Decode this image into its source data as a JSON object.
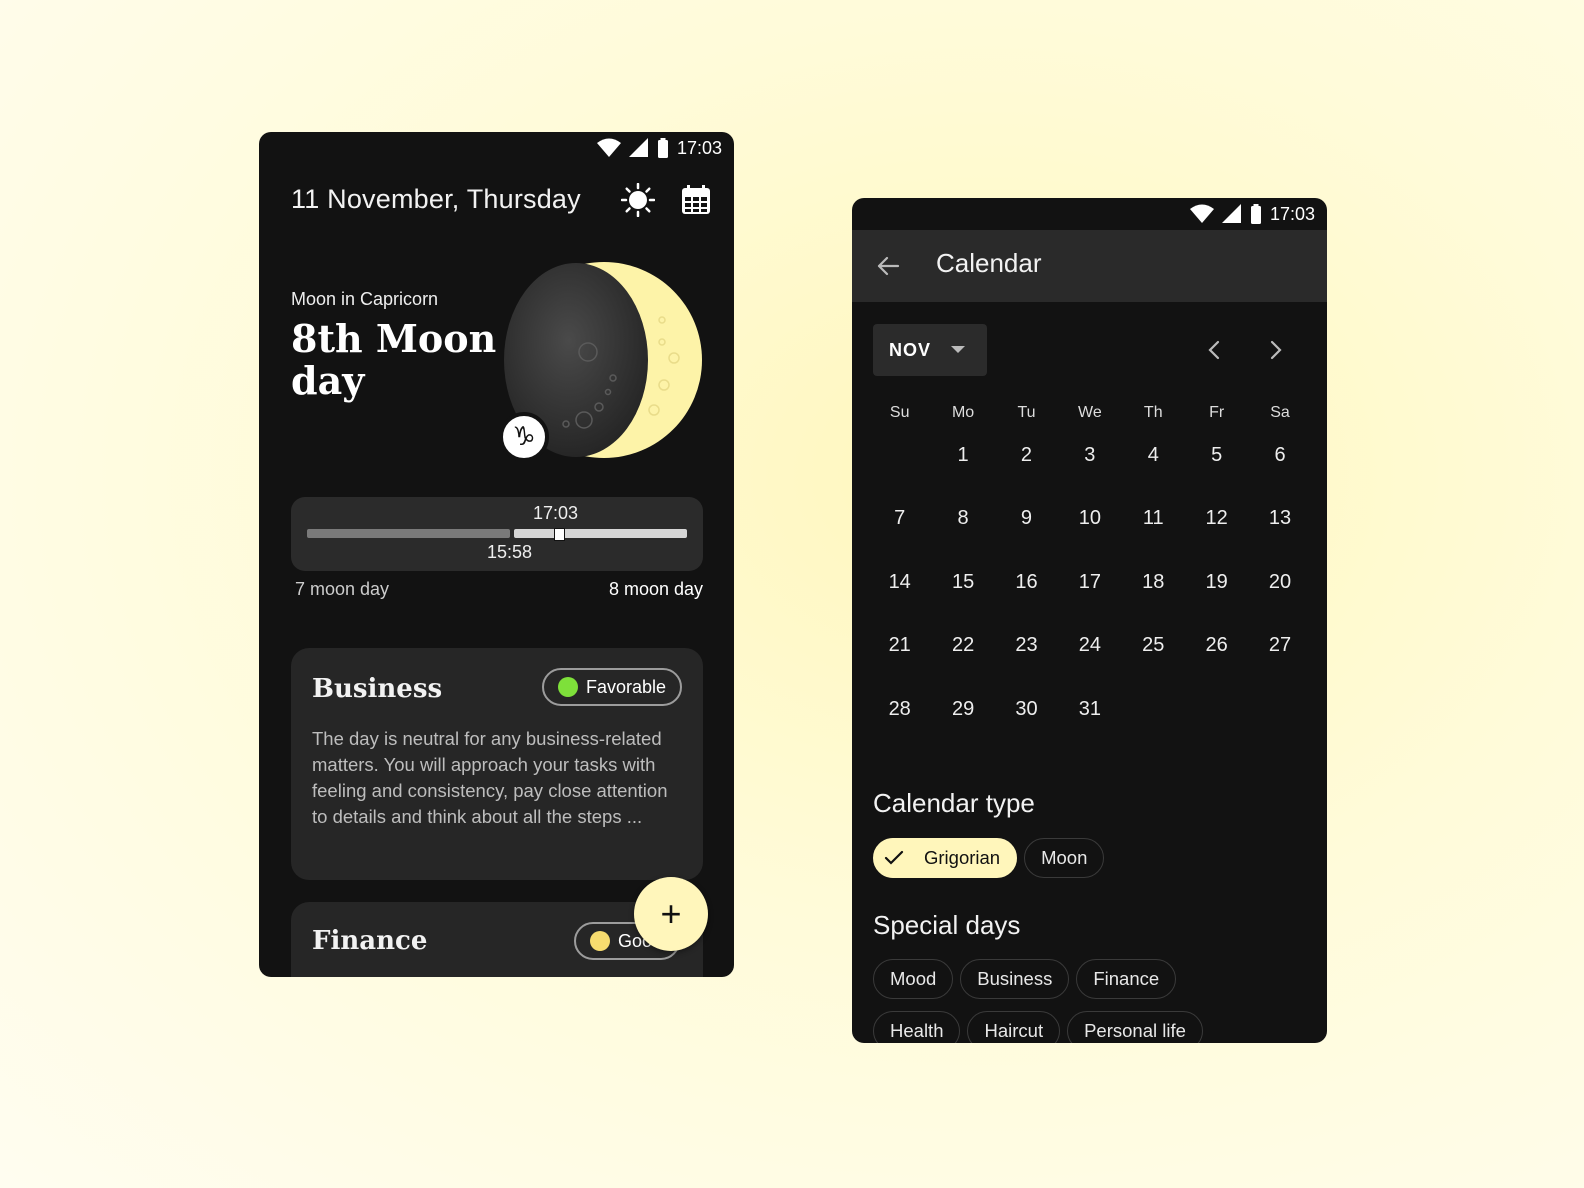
{
  "status": {
    "time": "17:03"
  },
  "moon_screen": {
    "date_title": "11 November, Thursday",
    "moon_sign": "Moon in Capricorn",
    "moon_day_title": "8th Moon day",
    "zodiac_symbol": "♑",
    "timeline": {
      "current_time": "17:03",
      "start_time": "15:58",
      "prev_label": "7 moon day",
      "next_label": "8 moon day"
    },
    "cards": [
      {
        "title": "Business",
        "badge": "Favorable",
        "badge_color": "#7ee03a",
        "text": "The day is neutral for any business-related matters. You will approach your tasks with feeling and consistency, pay close attention to details and think about all the steps ..."
      },
      {
        "title": "Finance",
        "badge": "Good",
        "badge_color": "#f7dc6f"
      }
    ],
    "fab_label": "+"
  },
  "calendar_screen": {
    "title": "Calendar",
    "month": "NOV",
    "weekdays": [
      "Su",
      "Mo",
      "Tu",
      "We",
      "Th",
      "Fr",
      "Sa"
    ],
    "days": [
      "",
      "1",
      "2",
      "3",
      "4",
      "5",
      "6",
      "7",
      "8",
      "9",
      "10",
      "11",
      "12",
      "13",
      "14",
      "15",
      "16",
      "17",
      "18",
      "19",
      "20",
      "21",
      "22",
      "23",
      "24",
      "25",
      "26",
      "27",
      "28",
      "29",
      "30",
      "31"
    ],
    "calendar_type_heading": "Calendar type",
    "calendar_types": [
      "Grigorian",
      "Moon"
    ],
    "selected_type": "Grigorian",
    "special_days_heading": "Special days",
    "special_days_row1": [
      "Mood",
      "Business",
      "Finance"
    ],
    "special_days_row2": [
      "Health",
      "Haircut",
      "Personal life"
    ]
  },
  "colors": {
    "accent": "#fff6bb",
    "moon": "#fdf3a8",
    "background": "#121212"
  }
}
